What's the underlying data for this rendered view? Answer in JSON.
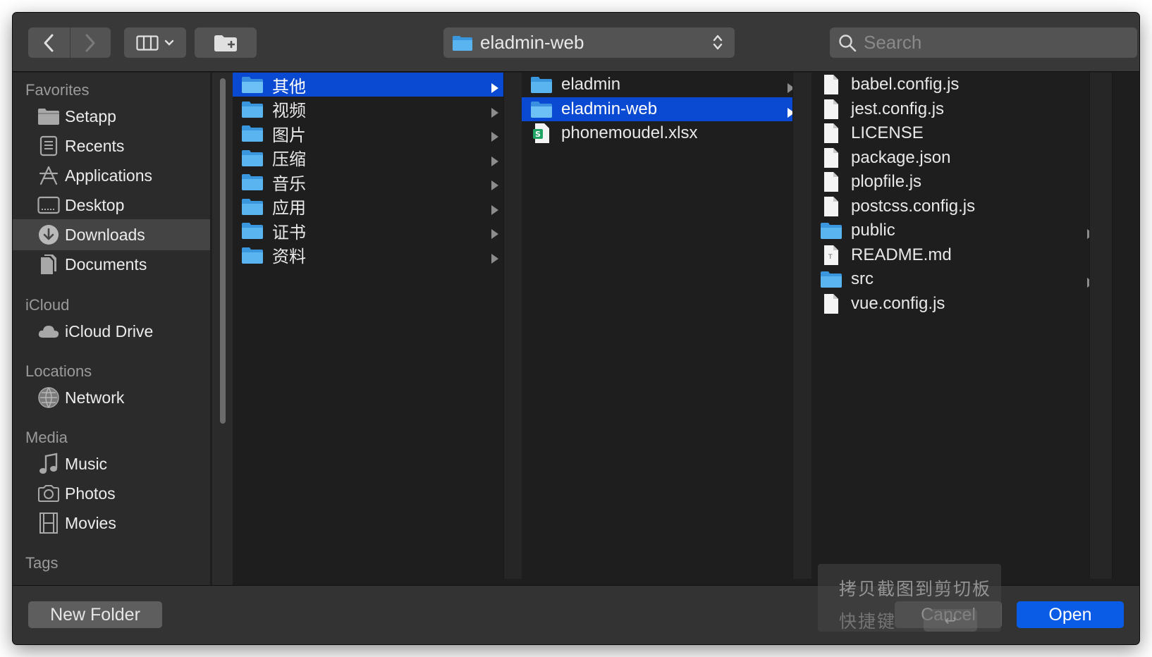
{
  "toolbar": {
    "path_label": "eladmin-web",
    "search_placeholder": "Search"
  },
  "sidebar": {
    "sections": [
      {
        "title": "Favorites",
        "items": [
          {
            "label": "Setapp",
            "icon": "folder-icon"
          },
          {
            "label": "Recents",
            "icon": "recents-icon"
          },
          {
            "label": "Applications",
            "icon": "applications-icon"
          },
          {
            "label": "Desktop",
            "icon": "desktop-icon"
          },
          {
            "label": "Downloads",
            "icon": "downloads-icon",
            "active": true
          },
          {
            "label": "Documents",
            "icon": "documents-icon"
          }
        ]
      },
      {
        "title": "iCloud",
        "items": [
          {
            "label": "iCloud Drive",
            "icon": "cloud-icon"
          }
        ]
      },
      {
        "title": "Locations",
        "items": [
          {
            "label": "Network",
            "icon": "network-icon"
          }
        ]
      },
      {
        "title": "Media",
        "items": [
          {
            "label": "Music",
            "icon": "music-icon"
          },
          {
            "label": "Photos",
            "icon": "camera-icon"
          },
          {
            "label": "Movies",
            "icon": "film-icon"
          }
        ]
      },
      {
        "title": "Tags",
        "items": []
      }
    ]
  },
  "columns": [
    {
      "items": [
        {
          "name": "其他",
          "type": "folder",
          "selected": true
        },
        {
          "name": "视频",
          "type": "folder"
        },
        {
          "name": "图片",
          "type": "folder"
        },
        {
          "name": "压缩",
          "type": "folder"
        },
        {
          "name": "音乐",
          "type": "folder"
        },
        {
          "name": "应用",
          "type": "folder"
        },
        {
          "name": "证书",
          "type": "folder"
        },
        {
          "name": "资料",
          "type": "folder"
        }
      ]
    },
    {
      "items": [
        {
          "name": "eladmin",
          "type": "folder"
        },
        {
          "name": "eladmin-web",
          "type": "folder",
          "selected": true
        },
        {
          "name": "phonemoudel.xlsx",
          "type": "spreadsheet"
        }
      ]
    },
    {
      "items": [
        {
          "name": "babel.config.js",
          "type": "file"
        },
        {
          "name": "jest.config.js",
          "type": "file"
        },
        {
          "name": "LICENSE",
          "type": "file"
        },
        {
          "name": "package.json",
          "type": "file"
        },
        {
          "name": "plopfile.js",
          "type": "file"
        },
        {
          "name": "postcss.config.js",
          "type": "file"
        },
        {
          "name": "public",
          "type": "folder"
        },
        {
          "name": "README.md",
          "type": "text"
        },
        {
          "name": "src",
          "type": "folder"
        },
        {
          "name": "vue.config.js",
          "type": "file"
        }
      ]
    }
  ],
  "footer": {
    "new_folder_label": "New Folder",
    "cancel_label": "Cancel",
    "open_label": "Open"
  },
  "tooltip": {
    "line1": "拷贝截图到剪切板",
    "line2": "快捷键",
    "shortcut": "↩"
  },
  "colors": {
    "selection": "#0a49d1",
    "open_button": "#0a5ce6",
    "folder": "#5ab4f0"
  }
}
